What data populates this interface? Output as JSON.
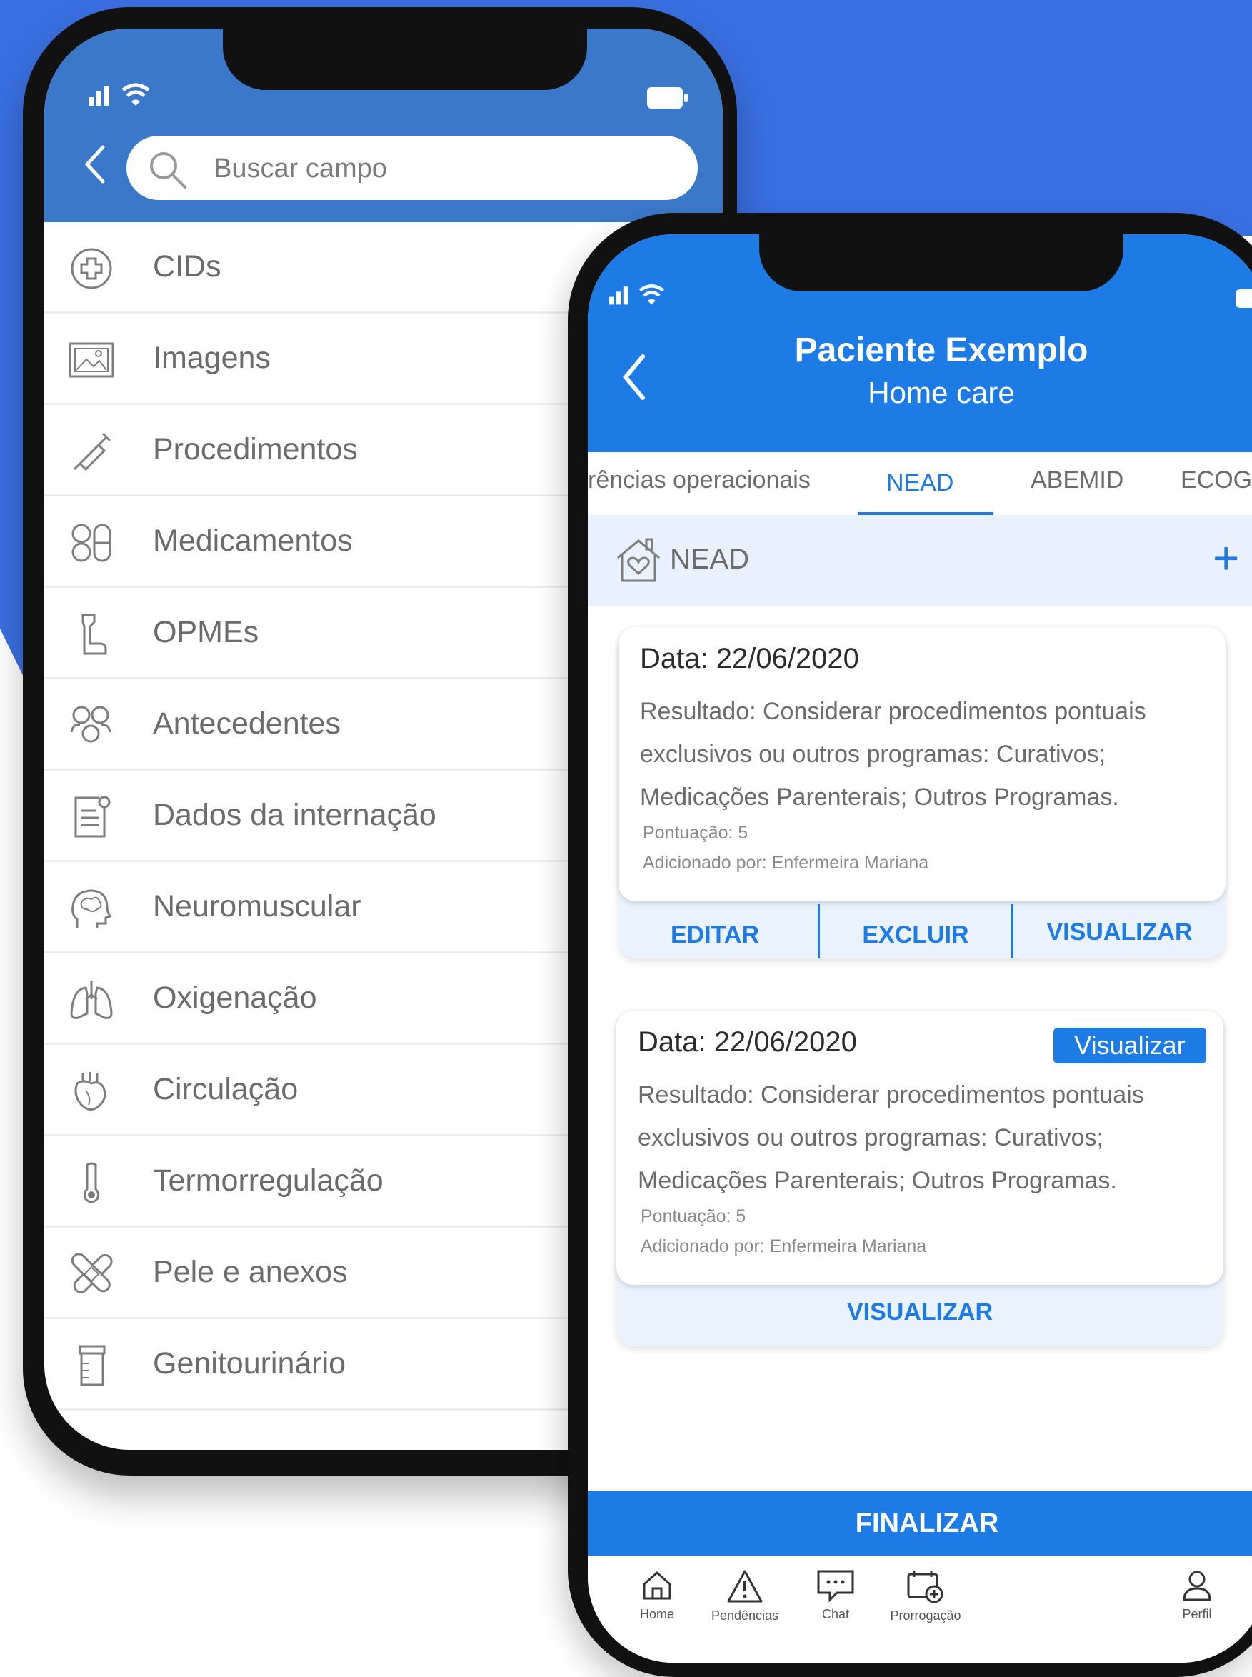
{
  "colors": {
    "background_blue": "#3a6fe0",
    "header_blue": "#3a78c9",
    "primary_blue": "#1d7be6",
    "section_bg": "#e9f1fd",
    "text_gray": "#6b6b6b"
  },
  "phone_left": {
    "search": {
      "placeholder": "Buscar campo"
    },
    "items": [
      {
        "label": "CIDs",
        "icon": "plus-circle-icon"
      },
      {
        "label": "Imagens",
        "icon": "image-icon"
      },
      {
        "label": "Procedimentos",
        "icon": "syringe-icon"
      },
      {
        "label": "Medicamentos",
        "icon": "pills-icon"
      },
      {
        "label": "OPMEs",
        "icon": "prosthesis-icon"
      },
      {
        "label": "Antecedentes",
        "icon": "family-icon"
      },
      {
        "label": "Dados da internação",
        "icon": "document-icon"
      },
      {
        "label": "Neuromuscular",
        "icon": "brain-head-icon"
      },
      {
        "label": "Oxigenação",
        "icon": "lungs-icon"
      },
      {
        "label": "Circulação",
        "icon": "heart-icon"
      },
      {
        "label": "Termorregulação",
        "icon": "thermometer-icon"
      },
      {
        "label": "Pele e anexos",
        "icon": "bandage-icon"
      },
      {
        "label": "Genitourinário",
        "icon": "urine-container-icon"
      }
    ]
  },
  "phone_right": {
    "header": {
      "title": "Paciente Exemplo",
      "subtitle": "Home care"
    },
    "tabs": [
      "rências operacionais",
      "NEAD",
      "ABEMID",
      "ECOG"
    ],
    "active_tab": "NEAD",
    "section": {
      "title": "NEAD",
      "add": "+"
    },
    "cards": [
      {
        "date": "Data: 22/06/2020",
        "result": "Resultado: Considerar procedimentos pontuais exclusivos ou outros programas: Curativos; Medicações Parenterais; Outros Programas.",
        "score": "Pontuação: 5",
        "added_by": "Adicionado por: Enfermeira Mariana",
        "actions": [
          "EDITAR",
          "EXCLUIR",
          "VISUALIZAR"
        ]
      },
      {
        "date": "Data: 22/06/2020",
        "badge": "Visualizar",
        "result": "Resultado: Considerar procedimentos pontuais exclusivos ou outros programas: Curativos; Medicações Parenterais; Outros Programas.",
        "score": "Pontuação: 5",
        "added_by": "Adicionado por: Enfermeira Mariana",
        "actions": [
          "VISUALIZAR"
        ]
      }
    ],
    "finalize_label": "FINALIZAR",
    "bottom_nav": [
      {
        "label": "Home",
        "icon": "home-icon"
      },
      {
        "label": "Pendências",
        "icon": "warning-icon"
      },
      {
        "label": "Chat",
        "icon": "chat-icon"
      },
      {
        "label": "Prorrogação",
        "icon": "calendar-add-icon"
      },
      {
        "label": "Perfil",
        "icon": "user-icon"
      }
    ]
  }
}
